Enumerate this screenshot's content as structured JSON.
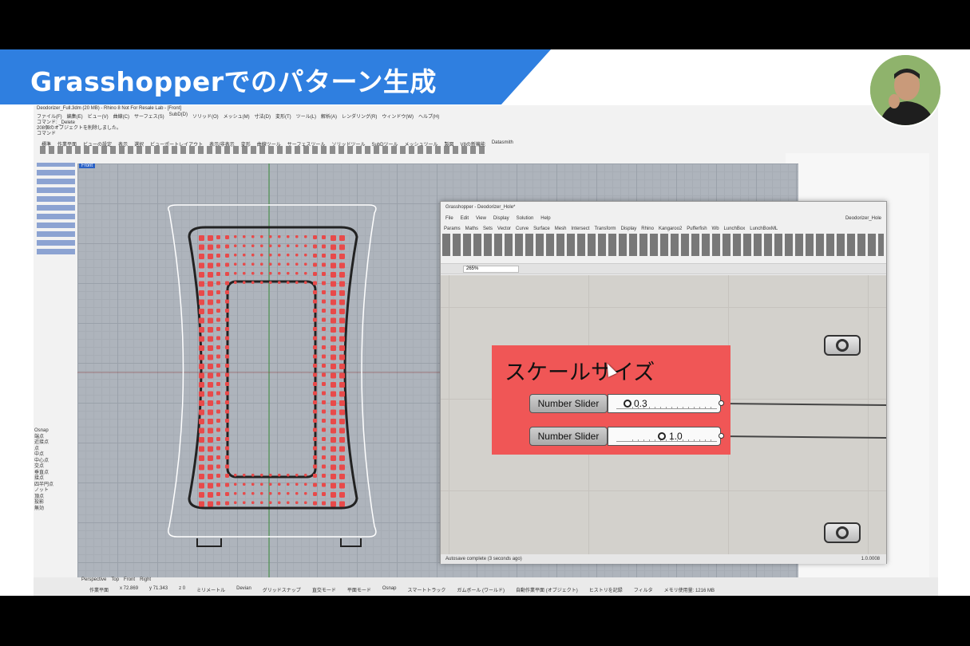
{
  "banner": {
    "title": "Grasshopperでのパターン生成"
  },
  "rhino": {
    "title": "Deodorizer_Full.3dm (20 MB) - Rhino 8 Not For Resale Lab - [Front]",
    "menu": [
      "ファイル(F)",
      "編集(E)",
      "ビュー(V)",
      "曲線(C)",
      "サーフェス(S)",
      "SubD(D)",
      "ソリッド(O)",
      "メッシュ(M)",
      "寸法(D)",
      "変形(T)",
      "ツール(L)",
      "解析(A)",
      "レンダリング(R)",
      "ウィンドウ(W)",
      "ヘルプ(H)"
    ],
    "command_lines": [
      "コマンド: _Delete",
      "208個のオブジェクトを削除しました。",
      "コマンド"
    ],
    "toolbar_tabs": [
      "標準",
      "作業平面",
      "ビューの設定",
      "表示",
      "選択",
      "ビューポートレイアウト",
      "表示/非表示",
      "変形",
      "曲線ツール",
      "サーフェスツール",
      "ソリッドツール",
      "SubDツール",
      "メッシュツール",
      "製図",
      "V8の新機能",
      "Datasmith"
    ],
    "viewport_label": "Front",
    "osnap_title": "Osnap",
    "osnap_items": [
      "端点",
      "近接点",
      "点",
      "中点",
      "中心点",
      "交点",
      "垂直点",
      "接点",
      "四半円点",
      "ノット",
      "頂点",
      "投影",
      "無効"
    ],
    "view_tabs": [
      "Perspective",
      "Top",
      "Front",
      "Right"
    ],
    "status": [
      "作業平面",
      "x 72.869",
      "y 71.343",
      "z 0",
      "ミリメートル",
      "Devian",
      "グリッドスナップ",
      "直交モード",
      "平面モード",
      "Osnap",
      "スマートトラック",
      "ガムボール (ワールド)",
      "自動作業平面 (オブジェクト)",
      "ヒストリを記録",
      "フィルタ",
      "メモリ使用量: 1216 MB"
    ]
  },
  "grasshopper": {
    "title": "Grasshopper - Deodorizer_Hole*",
    "menu": [
      "File",
      "Edit",
      "View",
      "Display",
      "Solution",
      "Help"
    ],
    "file_name": "Deodorizer_Hole",
    "tabs": [
      "Params",
      "Maths",
      "Sets",
      "Vector",
      "Curve",
      "Surface",
      "Mesh",
      "Intersect",
      "Transform",
      "Display",
      "Rhino",
      "Kangaroo2",
      "Pufferfish",
      "Wb",
      "LunchBox",
      "LunchBoxML"
    ],
    "zoom": "265%",
    "group_title": "スケールサイズ",
    "sliders": [
      {
        "label": "Number Slider",
        "value": "0.3"
      },
      {
        "label": "Number Slider",
        "value": "1.0"
      }
    ],
    "autosave": "Autosave complete (3 seconds ago)",
    "version": "1.0.0008"
  }
}
